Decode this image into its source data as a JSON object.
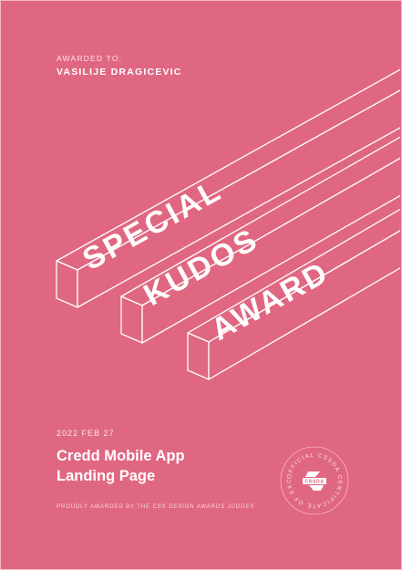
{
  "award": {
    "awarded_to_label": "AWARDED TO:",
    "recipient": "VASILIJE DRAGICEVIC",
    "beam_words": [
      "SPECIAL",
      "KUDOS",
      "AWARD"
    ],
    "date": "2022 FEB 27",
    "project_line1": "Credd Mobile App",
    "project_line2": "Landing Page",
    "footer": "PROUDLY AWARDED BY THE CSS DESIGN AWARDS JUDGES"
  },
  "seal": {
    "ring_text": "OFFICIAL CSSDA CERTIFICATE OF EXCELLENCE",
    "logo_text": "CSSDA",
    "logo_icon": "cssda-logo-icon"
  },
  "colors": {
    "background": "#e06782",
    "foreground": "#ffffff"
  }
}
